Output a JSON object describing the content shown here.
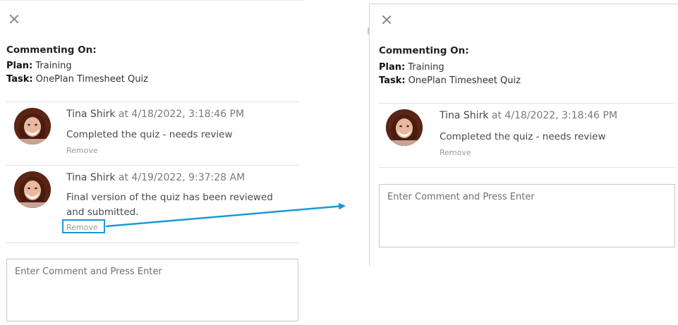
{
  "left": {
    "close_icon": "close-icon",
    "heading": "Commenting On:",
    "plan_label": "Plan:",
    "plan_value": " Training",
    "task_label": "Task:",
    "task_value": " OnePlan Timesheet Quiz",
    "comments": [
      {
        "author": "Tina Shirk",
        "timestamp": "at 4/18/2022, 3:18:46 PM",
        "text": "Completed the quiz - needs review",
        "remove_label": "Remove"
      },
      {
        "author": "Tina Shirk",
        "timestamp": "at 4/19/2022, 9:37:28 AM",
        "text": "Final version of the quiz has been reviewed and submitted.",
        "remove_label": "Remove"
      }
    ],
    "input_placeholder": "Enter Comment and Press Enter"
  },
  "right": {
    "close_icon": "close-icon",
    "heading": "Commenting On:",
    "plan_label": "Plan:",
    "plan_value": " Training",
    "task_label": "Task:",
    "task_value": " OnePlan Timesheet Quiz",
    "comments": [
      {
        "author": "Tina Shirk",
        "timestamp": "at 4/18/2022, 3:18:46 PM",
        "text": "Completed the quiz - needs review",
        "remove_label": "Remove"
      }
    ],
    "input_placeholder": "Enter Comment and Press Enter"
  },
  "annotation": {
    "highlight_color": "#1a9ad6"
  }
}
